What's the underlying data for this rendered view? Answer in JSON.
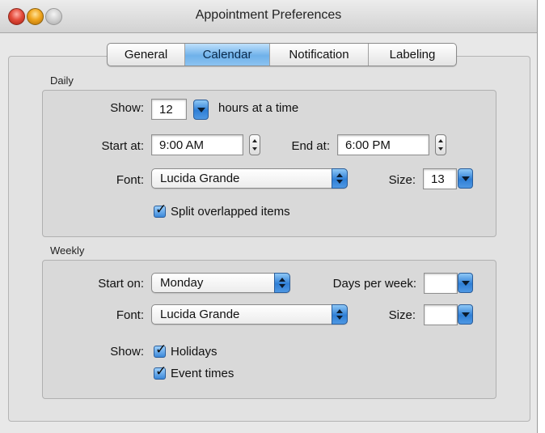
{
  "window": {
    "title": "Appointment Preferences"
  },
  "tabs": [
    {
      "label": "General"
    },
    {
      "label": "Calendar",
      "selected": true
    },
    {
      "label": "Notification"
    },
    {
      "label": "Labeling"
    }
  ],
  "daily": {
    "group_label": "Daily",
    "show_label": "Show:",
    "show_value": "12",
    "show_suffix": "hours at a time",
    "start_label": "Start at:",
    "start_value": "9:00 AM",
    "end_label": "End at:",
    "end_value": "6:00 PM",
    "font_label": "Font:",
    "font_value": "Lucida Grande",
    "size_label": "Size:",
    "size_value": "13",
    "split_label": "Split overlapped items",
    "split_checked": true
  },
  "weekly": {
    "group_label": "Weekly",
    "start_on_label": "Start on:",
    "start_on_value": "Monday",
    "days_label": "Days per week:",
    "days_value": "",
    "font_label": "Font:",
    "font_value": "Lucida Grande",
    "size_label": "Size:",
    "size_value": "",
    "show_label": "Show:",
    "holidays_label": "Holidays",
    "holidays_checked": true,
    "event_times_label": "Event times",
    "event_times_checked": true
  },
  "icons": {
    "close": "close-button-icon",
    "minimize": "minimize-button-icon",
    "zoom": "zoom-button-icon",
    "check": "checkmark-icon"
  },
  "colors": {
    "accent": "#3b88d9",
    "window_bg": "#e8e8e8",
    "close_red": "#e44c3c",
    "minimize_yellow": "#f0a51e"
  }
}
